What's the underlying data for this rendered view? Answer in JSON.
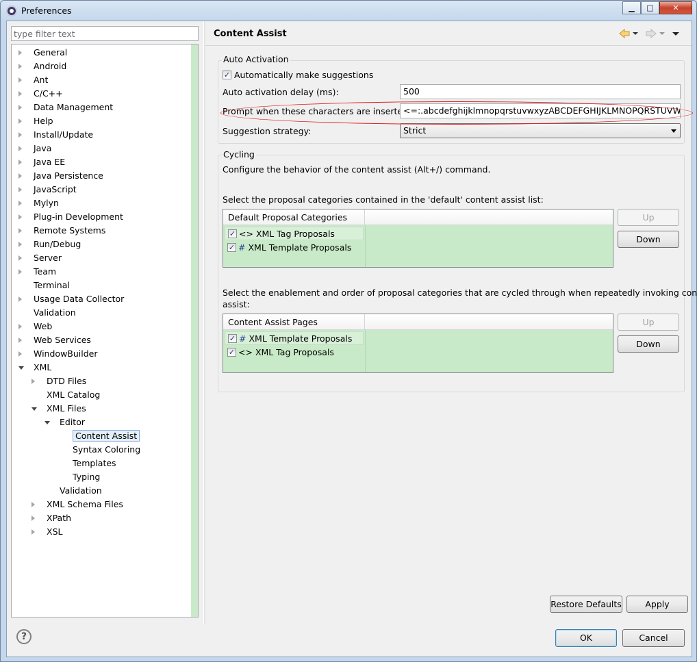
{
  "window": {
    "title": "Preferences",
    "min": "▁",
    "max": "□",
    "close": "✕"
  },
  "filter": {
    "placeholder": "type filter text"
  },
  "tree": [
    {
      "label": "General",
      "level": 0,
      "exp": "c"
    },
    {
      "label": "Android",
      "level": 0,
      "exp": "c"
    },
    {
      "label": "Ant",
      "level": 0,
      "exp": "c"
    },
    {
      "label": "C/C++",
      "level": 0,
      "exp": "c"
    },
    {
      "label": "Data Management",
      "level": 0,
      "exp": "c"
    },
    {
      "label": "Help",
      "level": 0,
      "exp": "c"
    },
    {
      "label": "Install/Update",
      "level": 0,
      "exp": "c"
    },
    {
      "label": "Java",
      "level": 0,
      "exp": "c"
    },
    {
      "label": "Java EE",
      "level": 0,
      "exp": "c"
    },
    {
      "label": "Java Persistence",
      "level": 0,
      "exp": "c"
    },
    {
      "label": "JavaScript",
      "level": 0,
      "exp": "c"
    },
    {
      "label": "Mylyn",
      "level": 0,
      "exp": "c"
    },
    {
      "label": "Plug-in Development",
      "level": 0,
      "exp": "c"
    },
    {
      "label": "Remote Systems",
      "level": 0,
      "exp": "c"
    },
    {
      "label": "Run/Debug",
      "level": 0,
      "exp": "c"
    },
    {
      "label": "Server",
      "level": 0,
      "exp": "c"
    },
    {
      "label": "Team",
      "level": 0,
      "exp": "c"
    },
    {
      "label": "Terminal",
      "level": 0,
      "exp": ""
    },
    {
      "label": "Usage Data Collector",
      "level": 0,
      "exp": "c"
    },
    {
      "label": "Validation",
      "level": 0,
      "exp": ""
    },
    {
      "label": "Web",
      "level": 0,
      "exp": "c"
    },
    {
      "label": "Web Services",
      "level": 0,
      "exp": "c"
    },
    {
      "label": "WindowBuilder",
      "level": 0,
      "exp": "c"
    },
    {
      "label": "XML",
      "level": 0,
      "exp": "e"
    },
    {
      "label": "DTD Files",
      "level": 1,
      "exp": "c"
    },
    {
      "label": "XML Catalog",
      "level": 1,
      "exp": ""
    },
    {
      "label": "XML Files",
      "level": 1,
      "exp": "e"
    },
    {
      "label": "Editor",
      "level": 2,
      "exp": "e"
    },
    {
      "label": "Content Assist",
      "level": 3,
      "exp": "",
      "selected": true
    },
    {
      "label": "Syntax Coloring",
      "level": 3,
      "exp": ""
    },
    {
      "label": "Templates",
      "level": 3,
      "exp": ""
    },
    {
      "label": "Typing",
      "level": 3,
      "exp": ""
    },
    {
      "label": "Validation",
      "level": 2,
      "exp": ""
    },
    {
      "label": "XML Schema Files",
      "level": 1,
      "exp": "c"
    },
    {
      "label": "XPath",
      "level": 1,
      "exp": "c"
    },
    {
      "label": "XSL",
      "level": 1,
      "exp": "c"
    }
  ],
  "page": {
    "title": "Content Assist"
  },
  "auto": {
    "group": "Auto Activation",
    "make_suggestions": "Automatically make suggestions",
    "delay_label": "Auto activation delay (ms):",
    "delay_value": "500",
    "prompt_label": "Prompt when these characters are inserted:",
    "prompt_value": "<=:.abcdefghijklmnopqrstuvwxyzABCDEFGHIJKLMNOPQRSTUVWXYZ",
    "strategy_label": "Suggestion strategy:",
    "strategy_value": "Strict"
  },
  "cycling": {
    "group": "Cycling",
    "desc": "Configure the behavior of the content assist (Alt+/) command.",
    "select1": "Select the proposal categories contained in the 'default' content assist list:",
    "table1_header": "Default Proposal Categories",
    "table1_rows": [
      {
        "icon": "<>",
        "label": "XML Tag Proposals"
      },
      {
        "icon": "#",
        "label": "XML Template Proposals"
      }
    ],
    "select2_line1": "Select the enablement and order of proposal categories that are cycled through when repeatedly invoking content",
    "select2_line2": "assist:",
    "table2_header": "Content Assist Pages",
    "table2_rows": [
      {
        "icon": "#",
        "label": "XML Template Proposals"
      },
      {
        "icon": "<>",
        "label": "XML Tag Proposals"
      }
    ],
    "up": "Up",
    "down": "Down"
  },
  "buttons": {
    "restore": "Restore Defaults",
    "apply": "Apply",
    "ok": "OK",
    "cancel": "Cancel",
    "help": "?"
  },
  "colors": {
    "highlight": "#c8eac8",
    "annotation": "#e02020"
  }
}
